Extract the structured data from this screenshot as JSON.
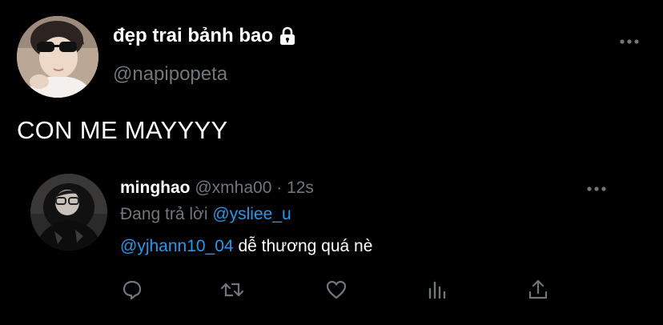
{
  "main_tweet": {
    "display_name": "đẹp trai bảnh bao",
    "handle": "@napipopeta",
    "text": "CON ME MAYYYY",
    "protected_icon": "lock-icon",
    "more_icon": "more-horizontal-icon"
  },
  "reply": {
    "name": "minghao",
    "handle": "@xmha00",
    "separator": "·",
    "time": "12s",
    "replying_prefix": "Đang trả lời",
    "replying_to": "@ysliee_u",
    "mention": "@yjhann10_04",
    "text": "dễ thương quá nè",
    "more_icon": "more-horizontal-icon"
  },
  "actions": [
    {
      "name": "reply",
      "icon": "comment-icon"
    },
    {
      "name": "retweet",
      "icon": "retweet-icon"
    },
    {
      "name": "like",
      "icon": "heart-icon"
    },
    {
      "name": "views",
      "icon": "analytics-icon"
    },
    {
      "name": "share",
      "icon": "share-icon"
    }
  ],
  "colors": {
    "background": "#000000",
    "primary_text": "#ffffff",
    "secondary_text": "#71767b",
    "accent": "#1d9bf0"
  }
}
